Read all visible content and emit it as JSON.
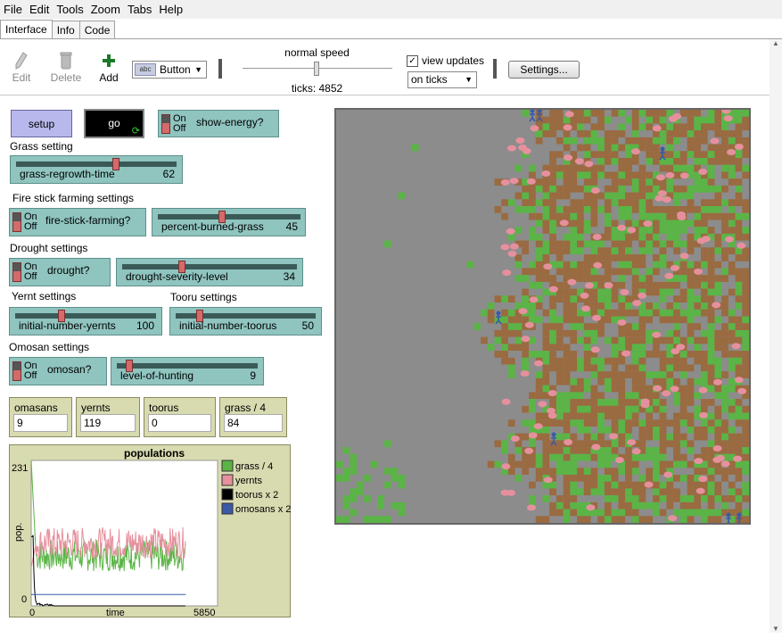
{
  "menu": [
    "File",
    "Edit",
    "Tools",
    "Zoom",
    "Tabs",
    "Help"
  ],
  "tabs": [
    "Interface",
    "Info",
    "Code"
  ],
  "toolbar": {
    "edit": "Edit",
    "delete": "Delete",
    "add": "Add",
    "widget_type": "Button",
    "speed_label": "normal speed",
    "ticks": "ticks: 4852",
    "view_updates": "view updates",
    "update_mode": "on ticks",
    "settings": "Settings..."
  },
  "buttons": {
    "setup": "setup",
    "go": "go"
  },
  "switches": {
    "on": "On",
    "off": "Off",
    "show_energy": "show-energy?",
    "fire_stick": "fire-stick-farming?",
    "drought": "drought?",
    "omosan": "omosan?"
  },
  "sections": {
    "grass": "Grass setting",
    "fire": "Fire stick farming settings",
    "drought": "Drought settings",
    "yernt": "Yernt settings",
    "tooru": "Tooru settings",
    "omosan": "Omosan settings"
  },
  "sliders": {
    "grass_regrowth": {
      "name": "grass-regrowth-time",
      "value": "62",
      "fraction": 0.62
    },
    "percent_burned": {
      "name": "percent-burned-grass",
      "value": "45",
      "fraction": 0.45
    },
    "drought_severity": {
      "name": "drought-severity-level",
      "value": "34",
      "fraction": 0.34
    },
    "init_yernts": {
      "name": "initial-number-yernts",
      "value": "100",
      "fraction": 0.33
    },
    "init_toorus": {
      "name": "initial-number-toorus",
      "value": "50",
      "fraction": 0.17
    },
    "hunting": {
      "name": "level-of-hunting",
      "value": "9",
      "fraction": 0.09
    }
  },
  "monitors": [
    {
      "name": "omasans",
      "value": "9"
    },
    {
      "name": "yernts",
      "value": "119"
    },
    {
      "name": "toorus",
      "value": "0"
    },
    {
      "name": "grass / 4",
      "value": "84"
    }
  ],
  "colors": {
    "grass": "#5bb446",
    "yernts": "#e6909e",
    "toorus": "#000000",
    "omosans": "#3a5aa8",
    "dirt": "#9a6a40",
    "background": "#8c8c8c"
  },
  "chart_data": {
    "type": "line",
    "title": "populations",
    "xlabel": "time",
    "ylabel": "pop.",
    "xlim": [
      0,
      5850
    ],
    "ylim": [
      0,
      231
    ],
    "ytick_labels": [
      "231",
      "0"
    ],
    "xtick_labels": [
      "0",
      "5850"
    ],
    "series": [
      {
        "name": "grass / 4",
        "color": "#5bb446"
      },
      {
        "name": "yernts",
        "color": "#e6909e"
      },
      {
        "name": "toorus x 2",
        "color": "#000000"
      },
      {
        "name": "omosans x 2",
        "color": "#3a5aa8"
      }
    ],
    "approx_values": {
      "grass_start_peak": 231,
      "grass_steady": 80,
      "yernts_steady": 100,
      "toorus_peak": 110,
      "omosans_steady": 18
    }
  }
}
